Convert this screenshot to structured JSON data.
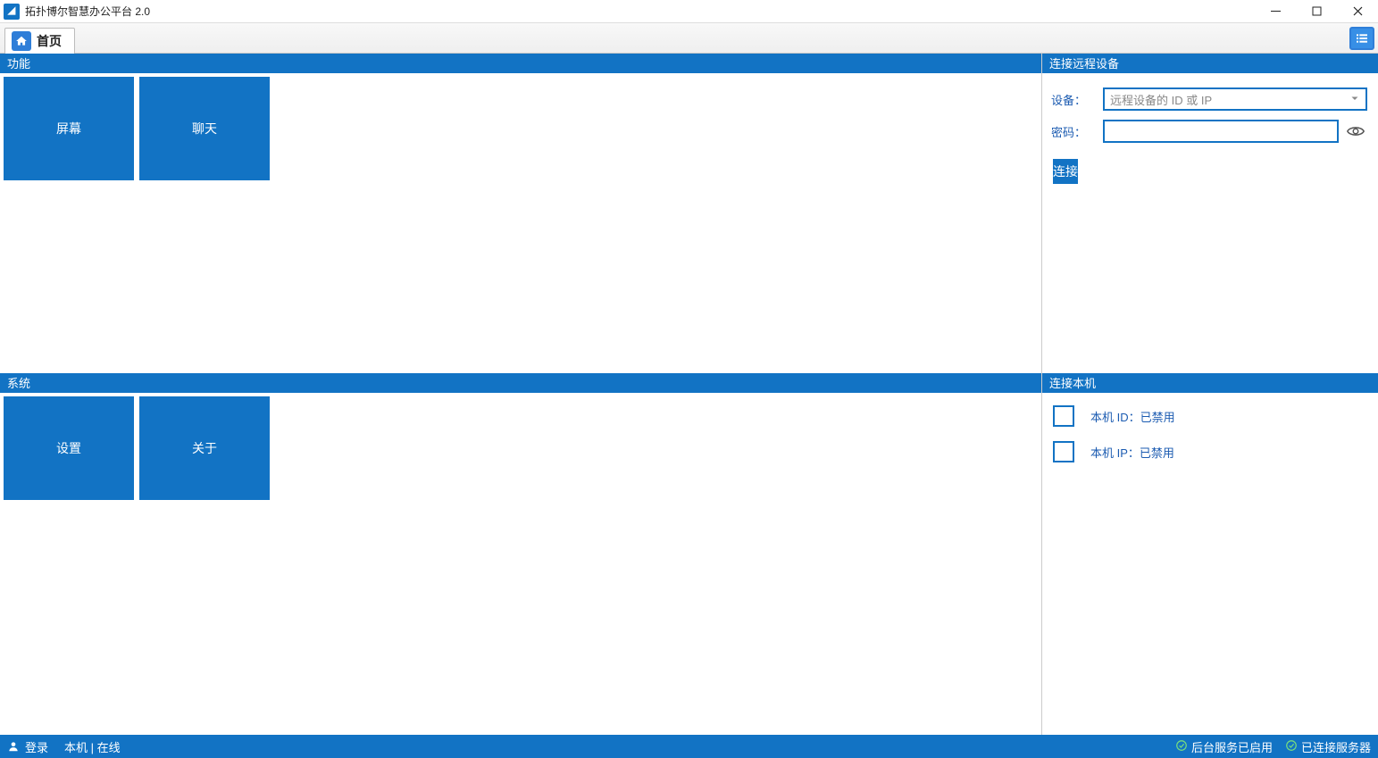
{
  "window": {
    "title": "拓扑博尔智慧办公平台 2.0"
  },
  "tabs": {
    "home_label": "首页"
  },
  "left": {
    "functions_header": "功能",
    "tiles": {
      "screen": "屏幕",
      "chat": "聊天"
    },
    "system_header": "系统",
    "sys_tiles": {
      "settings": "设置",
      "about": "关于"
    }
  },
  "right": {
    "remote_header": "连接远程设备",
    "device_label": "设备：",
    "device_placeholder": "远程设备的 ID 或 IP",
    "password_label": "密码：",
    "connect_label": "连接",
    "local_header": "连接本机",
    "local_id_label": "本机 ID：已禁用",
    "local_ip_label": "本机 IP：已禁用"
  },
  "status": {
    "login": "登录",
    "local_state": "本机 | 在线",
    "bg": "后台服务已启用",
    "server": "已连接服务器"
  },
  "icons": {
    "home": "home-icon",
    "menu": "list-icon",
    "eye": "eye-icon",
    "minimize": "minimize-icon",
    "maximize": "maximize-icon",
    "close": "close-icon",
    "person": "person-icon",
    "check": "check-circle-icon",
    "chevron": "chevron-down-icon"
  }
}
